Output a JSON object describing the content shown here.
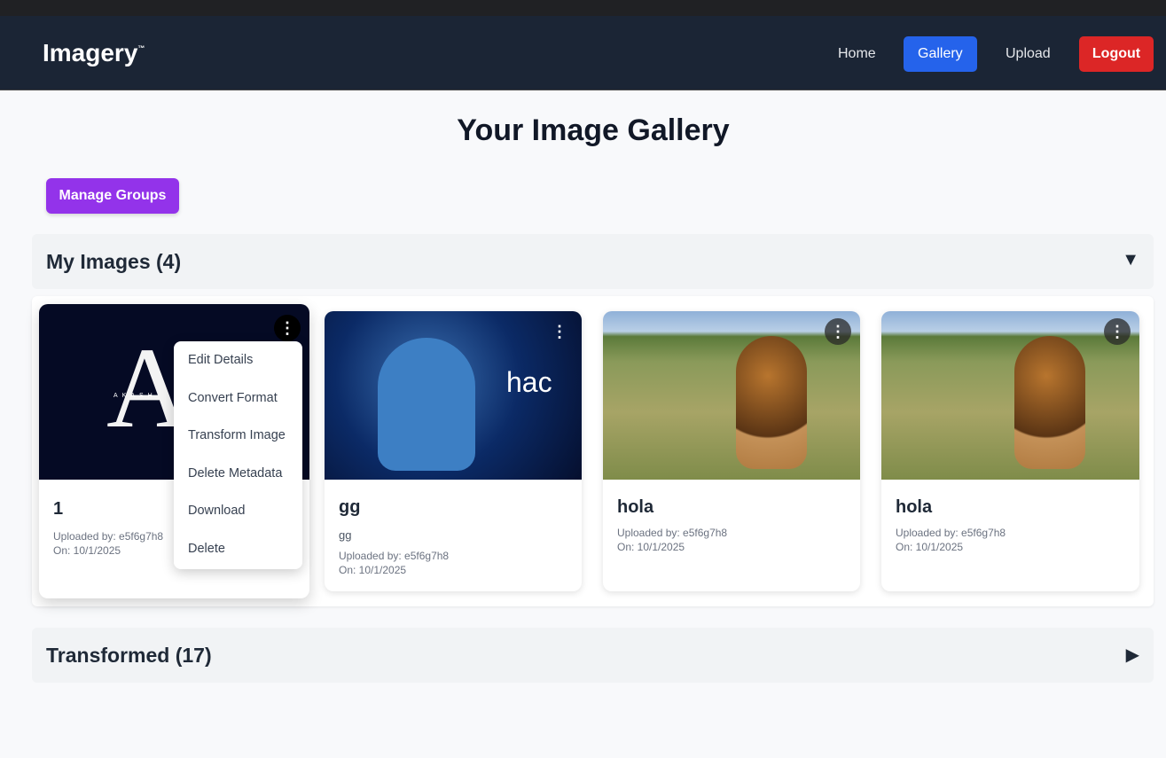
{
  "nav": {
    "brand": "Imagery",
    "tm": "™",
    "links": [
      "Home",
      "Gallery",
      "Upload",
      "Logout"
    ],
    "active": "Gallery"
  },
  "page": {
    "title": "Your Image Gallery",
    "manage_groups": "Manage Groups"
  },
  "sections": {
    "my_images": "My Images (4)",
    "transformed": "Transformed (17)"
  },
  "cards": [
    {
      "title": "1",
      "uploaded": "Uploaded by: e5f6g7h8",
      "date": "On: 10/1/2025",
      "logo_text": "AKASH"
    },
    {
      "title": "gg",
      "desc": "gg",
      "uploaded": "Uploaded by: e5f6g7h8",
      "date": "On: 10/1/2025",
      "image_text": "hac"
    },
    {
      "title": "hola",
      "uploaded": "Uploaded by: e5f6g7h8",
      "date": "On: 10/1/2025"
    },
    {
      "title": "hola",
      "uploaded": "Uploaded by: e5f6g7h8",
      "date": "On: 10/1/2025"
    }
  ],
  "menu": [
    "Edit Details",
    "Convert Format",
    "Transform Image",
    "Delete Metadata",
    "Download",
    "Delete"
  ],
  "colors": {
    "nav": "#1b2535",
    "gallery": "#2563eb",
    "logout": "#dc2626",
    "manage": "#9333ea"
  }
}
